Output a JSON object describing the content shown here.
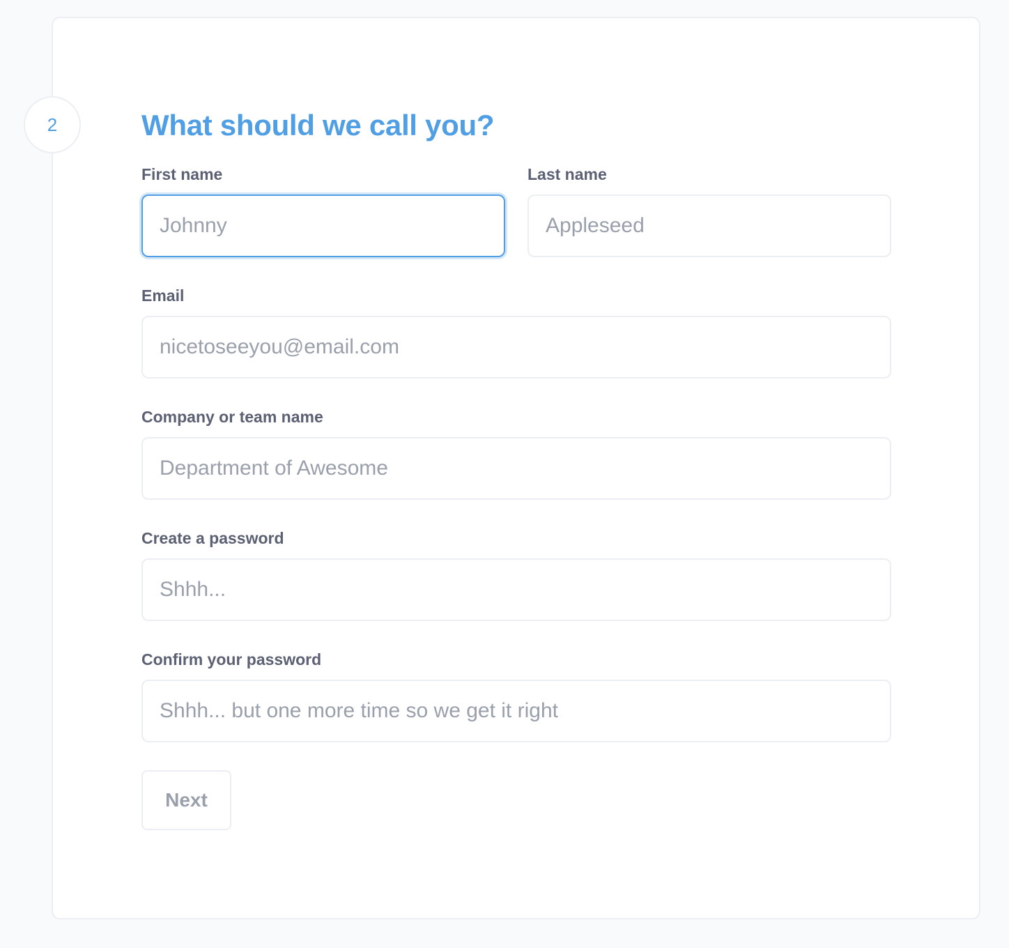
{
  "step": {
    "number": "2",
    "title": "What should we call you?"
  },
  "form": {
    "first_name": {
      "label": "First name",
      "placeholder": "Johnny",
      "value": ""
    },
    "last_name": {
      "label": "Last name",
      "placeholder": "Appleseed",
      "value": ""
    },
    "email": {
      "label": "Email",
      "placeholder": "nicetoseeyou@email.com",
      "value": ""
    },
    "company": {
      "label": "Company or team name",
      "placeholder": "Department of Awesome",
      "value": ""
    },
    "password": {
      "label": "Create a password",
      "placeholder": "Shhh...",
      "value": ""
    },
    "password_confirm": {
      "label": "Confirm your password",
      "placeholder": "Shhh... but one more time so we get it right",
      "value": ""
    },
    "next_label": "Next"
  },
  "colors": {
    "accent": "#509ee3",
    "label": "#5b6072",
    "placeholder": "#9aa0ab",
    "border": "#ebeef2",
    "page_background": "#f9fafc"
  }
}
